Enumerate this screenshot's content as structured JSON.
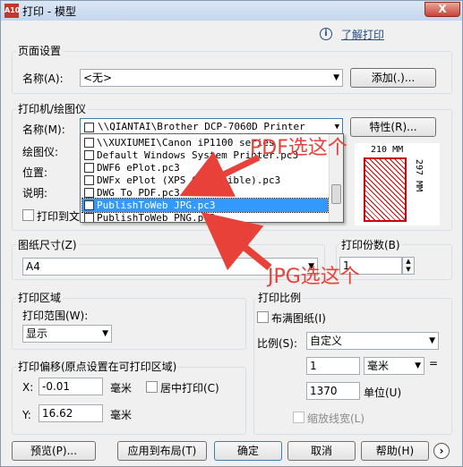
{
  "window": {
    "title": "打印 - 模型",
    "app_icon_text": "A10",
    "close_label": "X"
  },
  "help_link": "了解打印",
  "page_setup": {
    "group_label": "页面设置",
    "name_label": "名称(A):",
    "name_value": "<无>",
    "add_button": "添加(.)..."
  },
  "printer": {
    "group_label": "打印机/绘图仪",
    "name_label": "名称(M):",
    "name_value": "\\\\QIANTAI\\Brother DCP-7060D Printer",
    "properties_button": "特性(R)...",
    "plotter_label": "绘图仪:",
    "location_label": "位置:",
    "description_label": "说明:",
    "print_to_file_label": "打印到文件",
    "paper_width": "210 MM",
    "paper_height": "297 MM",
    "dropdown_items": [
      "\\\\XUXIUMEI\\Canon iP1100 series",
      "Default Windows System Printer.pc3",
      "DWF6 ePlot.pc3",
      "DWFx ePlot (XPS Compatible).pc3",
      "DWG To PDF.pc3",
      "PublishToWeb JPG.pc3",
      "PublishToWeb PNG.pc3"
    ],
    "selected_item": "PublishToWeb JPG.pc3"
  },
  "paper_size": {
    "group_label": "图纸尺寸(Z)",
    "value": "A4"
  },
  "copies": {
    "label": "打印份数(B)",
    "value": "1"
  },
  "plot_area": {
    "group_label": "打印区域",
    "range_label": "打印范围(W):",
    "range_value": "显示"
  },
  "plot_offset": {
    "group_label": "打印偏移(原点设置在可打印区域)",
    "x_label": "X:",
    "x_value": "-0.01",
    "x_unit": "毫米",
    "center_label": "居中打印(C)",
    "y_label": "Y:",
    "y_value": "16.62",
    "y_unit": "毫米"
  },
  "plot_scale": {
    "group_label": "打印比例",
    "fit_label": "布满图纸(I)",
    "scale_label": "比例(S):",
    "scale_value": "自定义",
    "value1": "1",
    "unit1": "毫米",
    "equals": "=",
    "value2": "1370",
    "unit2": "单位(U)",
    "lineweights_label": "缩放线宽(L)"
  },
  "buttons": {
    "preview": "预览(P)...",
    "apply": "应用到布局(T)",
    "ok": "确定",
    "cancel": "取消",
    "help": "帮助(H)",
    "more": "›"
  },
  "annotations": {
    "pdf": "PDF选这个",
    "jpg": "JPG选这个"
  },
  "colors": {
    "accent": "#e8413a",
    "selection": "#3399ff"
  }
}
